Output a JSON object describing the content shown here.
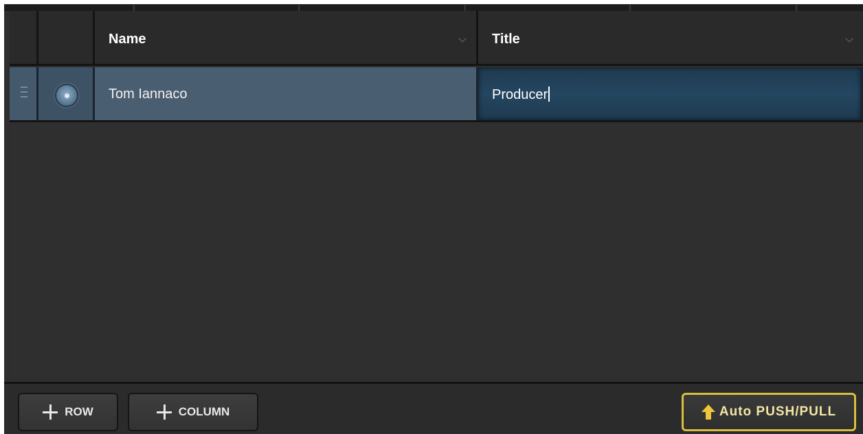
{
  "table": {
    "columns": [
      {
        "label": "Name"
      },
      {
        "label": "Title"
      }
    ],
    "rows": [
      {
        "name": "Tom Iannaco",
        "title": "Producer",
        "selected": true
      }
    ]
  },
  "toolbar": {
    "add_row_label": "ROW",
    "add_column_label": "COLUMN",
    "auto_push_pull_label": "Auto PUSH/PULL"
  },
  "colors": {
    "selected_row": "#4a5e71",
    "editing_cell": "#244660",
    "accent_outline": "#d9bf3b",
    "arrow": "#f0c53a"
  },
  "icons": {
    "drag_handle": "drag-handle-icon",
    "radio": "radio-selected-icon",
    "chevron": "chevron-down-icon",
    "plus": "plus-icon",
    "arrow": "arrow-up-icon"
  }
}
